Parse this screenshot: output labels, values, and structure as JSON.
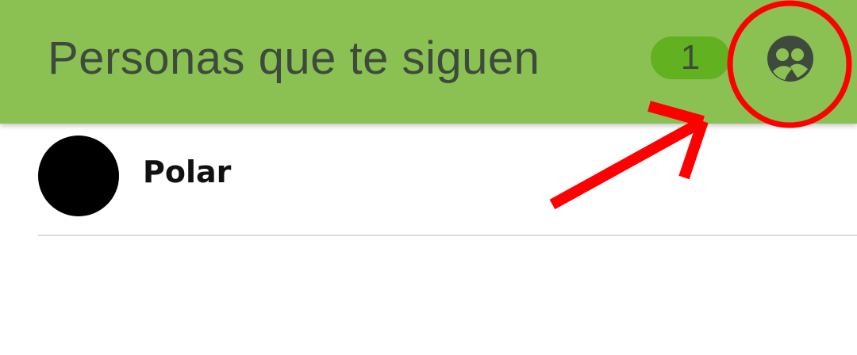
{
  "header": {
    "title": "Personas que te siguen",
    "count": "1",
    "group_icon": "group-icon",
    "colors": {
      "background": "#8bc152",
      "badge": "#62b120",
      "text": "#3e4a3d"
    }
  },
  "followers": [
    {
      "name": "Polar"
    }
  ],
  "annotation": {
    "circle_icon": "highlight-circle",
    "arrow_icon": "pointer-arrow",
    "color": "#ff0000"
  }
}
